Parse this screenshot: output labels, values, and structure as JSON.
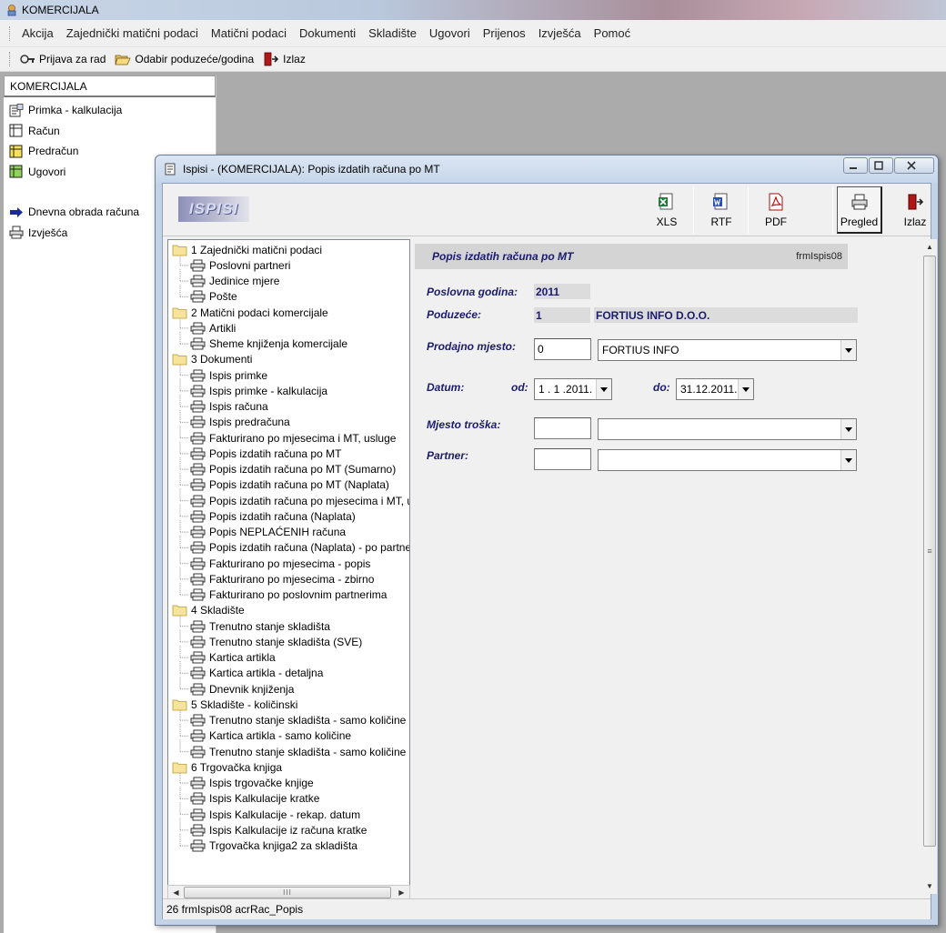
{
  "app": {
    "title": "KOMERCIJALA"
  },
  "menu": [
    "Akcija",
    "Zajednički matični podaci",
    "Matični podaci",
    "Dokumenti",
    "Skladište",
    "Ugovori",
    "Prijenos",
    "Izvješća",
    "Pomoć"
  ],
  "toolbar": {
    "login": "Prijava za rad",
    "select_company": "Odabir poduzeće/godina",
    "exit": "Izlaz"
  },
  "left_panel": {
    "header": "KOMERCIJALA",
    "items": [
      "Primka - kalkulacija",
      "Račun",
      "Predračun",
      "Ugovori"
    ],
    "items2": [
      "Dnevna obrada računa",
      "Izvješća"
    ]
  },
  "dialog": {
    "title": "Ispisi - (KOMERCIJALA):  Popis izdatih računa po MT",
    "logo": "ISPISI",
    "buttons": {
      "xls": "XLS",
      "rtf": "RTF",
      "pdf": "PDF",
      "preview": "Pregled",
      "exit": "Izlaz"
    },
    "status": "26 frmIspis08 acrRac_Popis"
  },
  "tree": [
    {
      "type": "folder",
      "label": "1 Zajednički matični podaci"
    },
    {
      "type": "leaf",
      "label": "Poslovni partneri"
    },
    {
      "type": "leaf",
      "label": "Jedinice mjere"
    },
    {
      "type": "leaf",
      "label": "Pošte"
    },
    {
      "type": "folder",
      "label": "2 Matični podaci komercijale"
    },
    {
      "type": "leaf",
      "label": "Artikli"
    },
    {
      "type": "leaf",
      "label": "Sheme knjiženja komercijale"
    },
    {
      "type": "folder",
      "label": "3 Dokumenti"
    },
    {
      "type": "leaf",
      "label": "Ispis primke"
    },
    {
      "type": "leaf",
      "label": "Ispis primke - kalkulacija"
    },
    {
      "type": "leaf",
      "label": "Ispis računa"
    },
    {
      "type": "leaf",
      "label": "Ispis predračuna"
    },
    {
      "type": "leaf",
      "label": "Fakturirano po mjesecima i MT, usluge"
    },
    {
      "type": "leaf",
      "label": "Popis izdatih računa po MT"
    },
    {
      "type": "leaf",
      "label": "Popis izdatih računa po MT (Sumarno)"
    },
    {
      "type": "leaf",
      "label": "Popis izdatih računa po MT (Naplata)"
    },
    {
      "type": "leaf",
      "label": "Popis izdatih računa po mjesecima i MT, ug"
    },
    {
      "type": "leaf",
      "label": "Popis izdatih računa (Naplata)"
    },
    {
      "type": "leaf",
      "label": "Popis NEPLAĆENIH računa"
    },
    {
      "type": "leaf",
      "label": "Popis izdatih računa (Naplata) - po partneru"
    },
    {
      "type": "leaf",
      "label": "Fakturirano po mjesecima - popis"
    },
    {
      "type": "leaf",
      "label": "Fakturirano po mjesecima - zbirno"
    },
    {
      "type": "leaf",
      "label": "Fakturirano po poslovnim partnerima"
    },
    {
      "type": "folder",
      "label": "4 Skladište"
    },
    {
      "type": "leaf",
      "label": "Trenutno stanje skladišta"
    },
    {
      "type": "leaf",
      "label": "Trenutno stanje skladišta (SVE)"
    },
    {
      "type": "leaf",
      "label": "Kartica artikla"
    },
    {
      "type": "leaf",
      "label": "Kartica artikla - detaljna"
    },
    {
      "type": "leaf",
      "label": "Dnevnik knjiženja"
    },
    {
      "type": "folder",
      "label": "5 Skladište - količinski"
    },
    {
      "type": "leaf",
      "label": "Trenutno stanje skladišta - samo količine"
    },
    {
      "type": "leaf",
      "label": "Kartica artikla - samo količine"
    },
    {
      "type": "leaf",
      "label": "Trenutno stanje skladišta - samo količine - p"
    },
    {
      "type": "folder",
      "label": "6 Trgovačka knjiga"
    },
    {
      "type": "leaf",
      "label": "Ispis trgovačke knjige"
    },
    {
      "type": "leaf",
      "label": "Ispis Kalkulacije kratke"
    },
    {
      "type": "leaf",
      "label": "Ispis Kalkulacije - rekap. datum"
    },
    {
      "type": "leaf",
      "label": "Ispis Kalkulacije iz računa kratke"
    },
    {
      "type": "leaf",
      "label": "Trgovačka knjiga2 za skladišta"
    }
  ],
  "form": {
    "title": "Popis izdatih računa po MT",
    "code": "frmIspis08",
    "year_label": "Poslovna godina:",
    "year_value": "2011",
    "company_label": "Poduzeće:",
    "company_id": "1",
    "company_name": "FORTIUS INFO D.O.O.",
    "sales_label": "Prodajno mjesto:",
    "sales_code": "0",
    "sales_name": "FORTIUS INFO",
    "date_label": "Datum:",
    "from_label": "od:",
    "from_value": "1 . 1 .2011.",
    "to_label": "do:",
    "to_value": "31.12.2011.",
    "cost_label": "Mjesto troška:",
    "cost_code": "",
    "cost_name": "",
    "partner_label": "Partner:",
    "partner_code": "",
    "partner_name": ""
  },
  "colors": {
    "label_blue": "#1c1c6c",
    "title_bar": "#c6d6ea"
  }
}
